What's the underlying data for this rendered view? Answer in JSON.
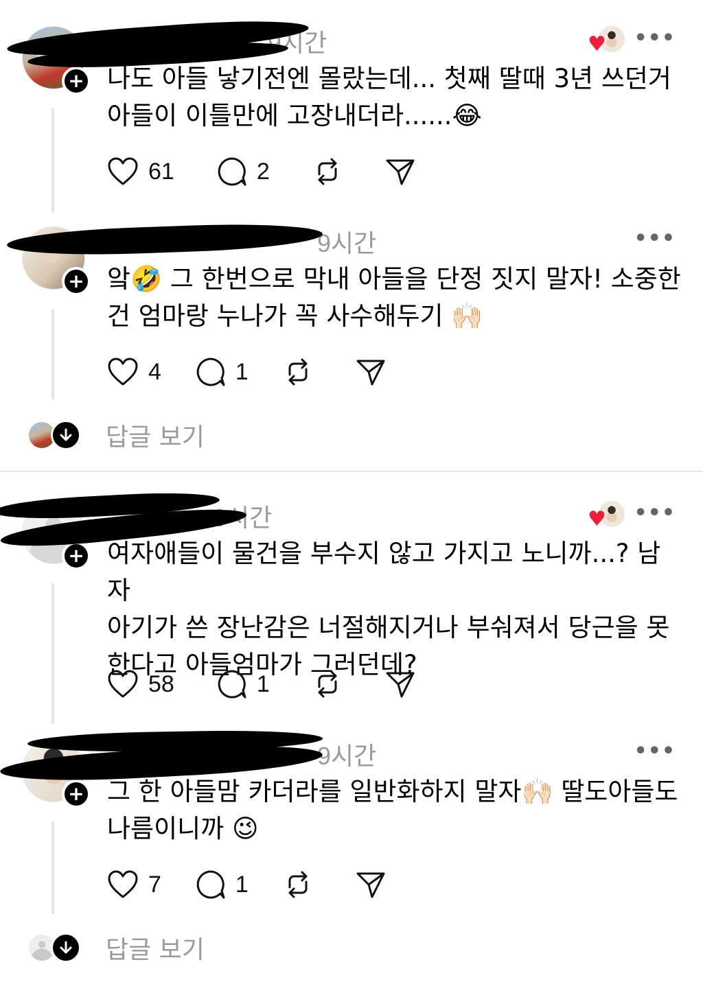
{
  "posts": [
    {
      "time": "9시간",
      "text_lines": [
        "나도 아들 낳기전엔 몰랐는데... 첫째 딸때 3년 쓰던거",
        "아들이 이틀만에 고장내더라......😂"
      ],
      "likes": "61",
      "replies": "2",
      "liked_by_author": true
    },
    {
      "time": "9시간",
      "text_lines": [
        "앜🤣 그 한번으로 막내 아들을 단정 짓지 말자! 소중한",
        "건 엄마랑 누나가 꼭 사수해두기 🙌🏻"
      ],
      "likes": "4",
      "replies": "1",
      "liked_by_author": false
    },
    {
      "time": "9시간",
      "text_lines": [
        "여자애들이 물건을 부수지 않고 가지고 노니까...? 남자",
        "아기가 쓴 장난감은 너절해지거나 부숴져서 당근을 못",
        "한다고 아들엄마가 그러던데?"
      ],
      "likes": "58",
      "replies": "1",
      "liked_by_author": true
    },
    {
      "time": "9시간",
      "text_lines": [
        "그 한 아들맘 카더라를 일반화하지 말자🙌🏻 딸도아들도",
        "나름이니까 😉"
      ],
      "likes": "7",
      "replies": "1",
      "liked_by_author": false
    }
  ],
  "view_replies_label": "답글 보기",
  "more_icon": "more-horizontal-icon",
  "colors": {
    "heart": "#ee1f3a",
    "muted": "#9a9a9a",
    "divider": "#e8e8e8"
  }
}
